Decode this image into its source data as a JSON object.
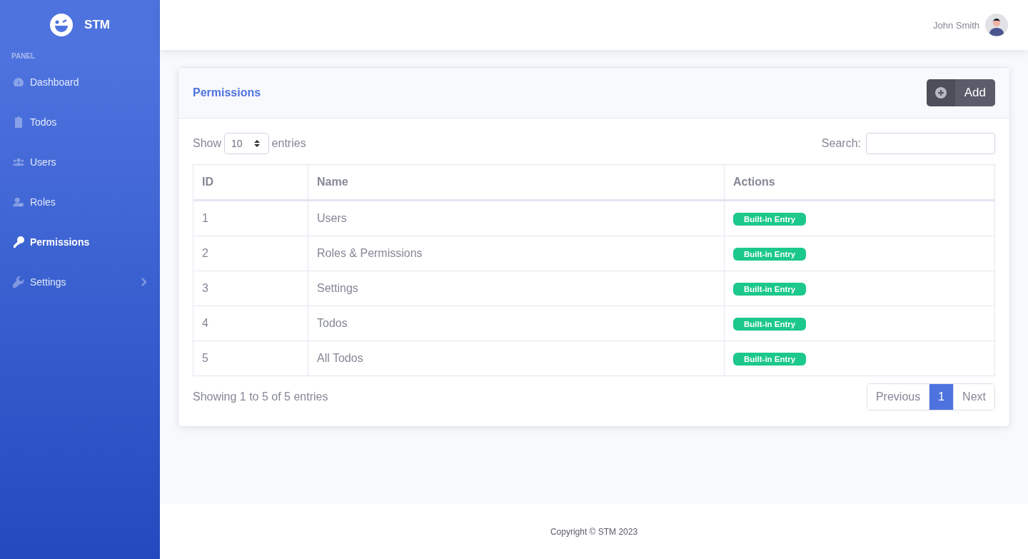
{
  "sidebar": {
    "brand": "STM",
    "section": "PANEL",
    "items": [
      {
        "label": "Dashboard",
        "kind": "gauge",
        "selected": false,
        "expandable": false
      },
      {
        "label": "Todos",
        "kind": "clipboard",
        "selected": false,
        "expandable": false
      },
      {
        "label": "Users",
        "kind": "users",
        "selected": false,
        "expandable": false
      },
      {
        "label": "Roles",
        "kind": "user",
        "selected": false,
        "expandable": false
      },
      {
        "label": "Permissions",
        "kind": "key",
        "selected": true,
        "expandable": false
      },
      {
        "label": "Settings",
        "kind": "wrench",
        "selected": false,
        "expandable": true
      }
    ]
  },
  "topbar": {
    "user_name": "John Smith"
  },
  "card": {
    "title": "Permissions",
    "add_button": "Add",
    "length": {
      "before": "Show",
      "value": "10",
      "after": "entries"
    },
    "search": {
      "label": "Search:"
    },
    "table": {
      "columns": [
        "ID",
        "Name",
        "Actions"
      ],
      "rows": [
        {
          "id": "1",
          "name": "Users",
          "badge": "Built-in Entry"
        },
        {
          "id": "2",
          "name": "Roles & Permissions",
          "badge": "Built-in Entry"
        },
        {
          "id": "3",
          "name": "Settings",
          "badge": "Built-in Entry"
        },
        {
          "id": "4",
          "name": "Todos",
          "badge": "Built-in Entry"
        },
        {
          "id": "5",
          "name": "All Todos",
          "badge": "Built-in Entry"
        }
      ]
    },
    "info": "Showing 1 to 5 of 5 entries",
    "pagination": [
      {
        "label": "Previous",
        "selected": false
      },
      {
        "label": "1",
        "selected": true
      },
      {
        "label": "Next",
        "selected": false
      }
    ]
  },
  "footer": {
    "text": "Copyright © STM 2023"
  }
}
